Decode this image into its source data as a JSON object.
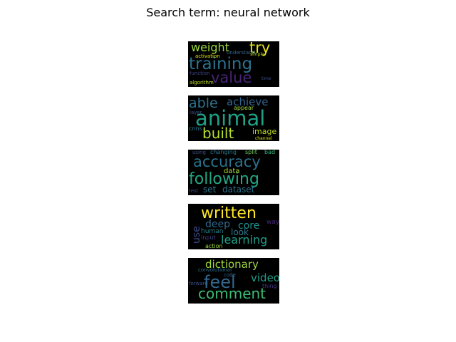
{
  "title": "Search term: neural network",
  "clouds": [
    {
      "words": [
        {
          "text": "weight",
          "color": "#9bd93c"
        },
        {
          "text": "try",
          "color": "#e5e419"
        },
        {
          "text": "training",
          "color": "#2c728e"
        },
        {
          "text": "value",
          "color": "#482475"
        },
        {
          "text": "activation",
          "color": "#e5e419"
        },
        {
          "text": "understand",
          "color": "#31688e"
        },
        {
          "text": "simple",
          "color": "#c2df23"
        },
        {
          "text": "function",
          "color": "#414487"
        },
        {
          "text": "time",
          "color": "#3b528b"
        },
        {
          "text": "algorithm",
          "color": "#c2df23"
        }
      ]
    },
    {
      "words": [
        {
          "text": "able",
          "color": "#2c728e"
        },
        {
          "text": "achieve",
          "color": "#33638d"
        },
        {
          "text": "animal",
          "color": "#1fa187"
        },
        {
          "text": "built",
          "color": "#b5de2b"
        },
        {
          "text": "image",
          "color": "#c2df23"
        },
        {
          "text": "appear",
          "color": "#a0da39"
        },
        {
          "text": "cnns",
          "color": "#2a788e"
        },
        {
          "text": "layer",
          "color": "#3b528b"
        },
        {
          "text": "channel",
          "color": "#d8e219"
        }
      ]
    },
    {
      "words": [
        {
          "text": "using",
          "color": "#3b528b"
        },
        {
          "text": "changing",
          "color": "#2a788e"
        },
        {
          "text": "split",
          "color": "#6ece58"
        },
        {
          "text": "bad",
          "color": "#35b779"
        },
        {
          "text": "accuracy",
          "color": "#2c728e"
        },
        {
          "text": "data",
          "color": "#b5de2b"
        },
        {
          "text": "following",
          "color": "#22a884"
        },
        {
          "text": "test",
          "color": "#3e4989"
        },
        {
          "text": "set",
          "color": "#2a788e"
        },
        {
          "text": "dataset",
          "color": "#2c728e"
        }
      ]
    },
    {
      "words": [
        {
          "text": "written",
          "color": "#fde725"
        },
        {
          "text": "deep",
          "color": "#31688e"
        },
        {
          "text": "core",
          "color": "#21918c"
        },
        {
          "text": "way",
          "color": "#482878"
        },
        {
          "text": "use",
          "color": "#3e4989"
        },
        {
          "text": "human",
          "color": "#26828e"
        },
        {
          "text": "look",
          "color": "#2a788e"
        },
        {
          "text": "input",
          "color": "#414487"
        },
        {
          "text": "learning",
          "color": "#1f9e89"
        },
        {
          "text": "action",
          "color": "#9bd93c"
        }
      ]
    },
    {
      "words": [
        {
          "text": "dictionary",
          "color": "#a0da39"
        },
        {
          "text": "convolutional",
          "color": "#2c728e"
        },
        {
          "text": "code",
          "color": "#33638d"
        },
        {
          "text": "video",
          "color": "#1f9e89"
        },
        {
          "text": "forward",
          "color": "#3b528b"
        },
        {
          "text": "feel",
          "color": "#31688e"
        },
        {
          "text": "thing",
          "color": "#443983"
        },
        {
          "text": "comment",
          "color": "#3bbb75"
        }
      ]
    }
  ]
}
